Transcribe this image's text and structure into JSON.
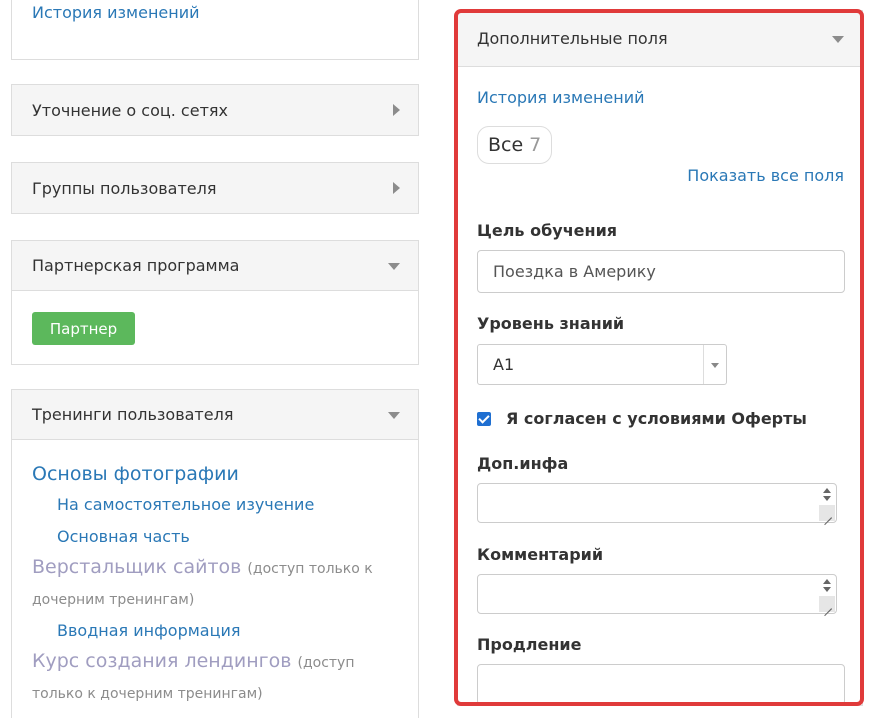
{
  "left": {
    "top_panel": {
      "history_link": "История изменений"
    },
    "social_panel": {
      "title": "Уточнение о соц. сетях"
    },
    "groups_panel": {
      "title": "Группы пользователя"
    },
    "partner_panel": {
      "title": "Партнерская программа",
      "button": "Партнер"
    },
    "trainings_panel": {
      "title": "Тренинги пользователя",
      "items": [
        {
          "title": "Основы фотографии"
        },
        {
          "sub": "На самостоятельное изучение"
        },
        {
          "sub": "Основная часть"
        },
        {
          "title": "Верстальщик сайтов",
          "note": "(доступ только к дочерним тренингам)"
        },
        {
          "sub": "Вводная информация"
        },
        {
          "title": "Курс создания лендингов",
          "note": "(доступ только к дочерним тренингам)"
        }
      ]
    }
  },
  "right": {
    "title": "Дополнительные поля",
    "history_link": "История изменений",
    "filter_chip": {
      "label": "Все",
      "count": "7"
    },
    "show_all_link": "Показать все поля",
    "fields": {
      "goal": {
        "label": "Цель обучения",
        "value": "Поездка в Америку"
      },
      "level": {
        "label": "Уровень знаний",
        "value": "A1"
      },
      "agree": {
        "label": "Я согласен с условиями Оферты",
        "checked": true
      },
      "extra": {
        "label": "Доп.инфа",
        "value": ""
      },
      "comment": {
        "label": "Комментарий",
        "value": ""
      },
      "extension": {
        "label": "Продление",
        "value": ""
      }
    }
  },
  "colors": {
    "highlight": "#e03a3a",
    "link": "#2a78b6",
    "partner_button": "#5cb85c",
    "checkbox": "#1f6fd1",
    "gray_training": "#a09dc0"
  }
}
